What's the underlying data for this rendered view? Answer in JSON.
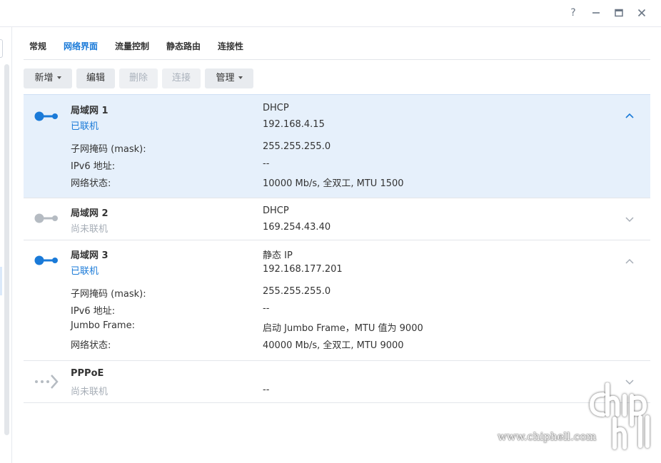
{
  "window": {
    "help": "?"
  },
  "tabs": [
    {
      "label": "常规"
    },
    {
      "label": "网络界面"
    },
    {
      "label": "流量控制"
    },
    {
      "label": "静态路由"
    },
    {
      "label": "连接性"
    }
  ],
  "toolbar": {
    "create": "新增",
    "edit": "编辑",
    "delete": "删除",
    "connect": "连接",
    "manage": "管理"
  },
  "interfaces": [
    {
      "name": "局域网 1",
      "status": "已联机",
      "mode": "DHCP",
      "ip": "192.168.4.15",
      "details": [
        {
          "label": "子网掩码 (mask):",
          "value": "255.255.255.0"
        },
        {
          "label": "IPv6 地址:",
          "value": "--"
        },
        {
          "label": "网络状态:",
          "value": "10000 Mb/s, 全双工, MTU 1500"
        }
      ]
    },
    {
      "name": "局域网 2",
      "status": "尚未联机",
      "mode": "DHCP",
      "ip": "169.254.43.40"
    },
    {
      "name": "局域网 3",
      "status": "已联机",
      "mode": "静态 IP",
      "ip": "192.168.177.201",
      "details": [
        {
          "label": "子网掩码 (mask):",
          "value": "255.255.255.0"
        },
        {
          "label": "IPv6 地址:",
          "value": "--"
        },
        {
          "label": "Jumbo Frame:",
          "value": "启动 Jumbo Frame，MTU 值为 9000"
        },
        {
          "label": "网络状态:",
          "value": "40000 Mb/s, 全双工, MTU 9000"
        }
      ]
    },
    {
      "name": "PPPoE",
      "status": "尚未联机",
      "ip": "--"
    }
  ],
  "watermark": {
    "text": "www.chiphell.com"
  },
  "colors": {
    "accent": "#1a7ad8",
    "inactive": "#b5bbc2",
    "selected_bg": "#e6f0fb"
  }
}
